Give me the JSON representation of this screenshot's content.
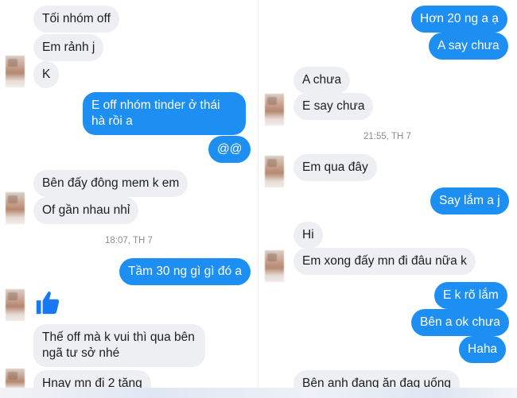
{
  "left_panel": {
    "messages": [
      {
        "text": "Tối nhóm off"
      },
      {
        "text": "Em rảnh j"
      },
      {
        "text": "K"
      },
      {
        "text": "E off nhóm tinder ở thái hà rồi a"
      },
      {
        "text": "@@"
      },
      {
        "text": "Bên đấy đông mem k em"
      },
      {
        "text": "Of gần nhau nhỉ"
      },
      {
        "text": "Tầm 30 ng gì gì đó a"
      },
      {
        "text": "Thế off mà k vui thì qua bên ngã tư sở nhé"
      },
      {
        "text": "Hnay mn đi 2 tăng"
      }
    ],
    "timestamp": "18:07, TH 7",
    "like_icon": "thumbs-up-icon"
  },
  "right_panel": {
    "messages": [
      {
        "text": "Hơn 20 ng a ạ"
      },
      {
        "text": "A say chưa"
      },
      {
        "text": "A chưa"
      },
      {
        "text": "E say chưa"
      },
      {
        "text": "Em qua đây"
      },
      {
        "text": "Say lắm a j"
      },
      {
        "text": "Hi"
      },
      {
        "text": "Em xong đấy mn đi đâu nữa k"
      },
      {
        "text": "E k rõ lắm"
      },
      {
        "text": "Bên a ok chưa"
      },
      {
        "text": "Haha"
      },
      {
        "text": "Bên anh đang ăn đag uống"
      }
    ],
    "timestamp": "21:55, TH 7"
  },
  "colors": {
    "outgoing_bubble": "#1d8ff2",
    "incoming_bubble": "#eeeff2",
    "like_icon": "#1877f2"
  }
}
